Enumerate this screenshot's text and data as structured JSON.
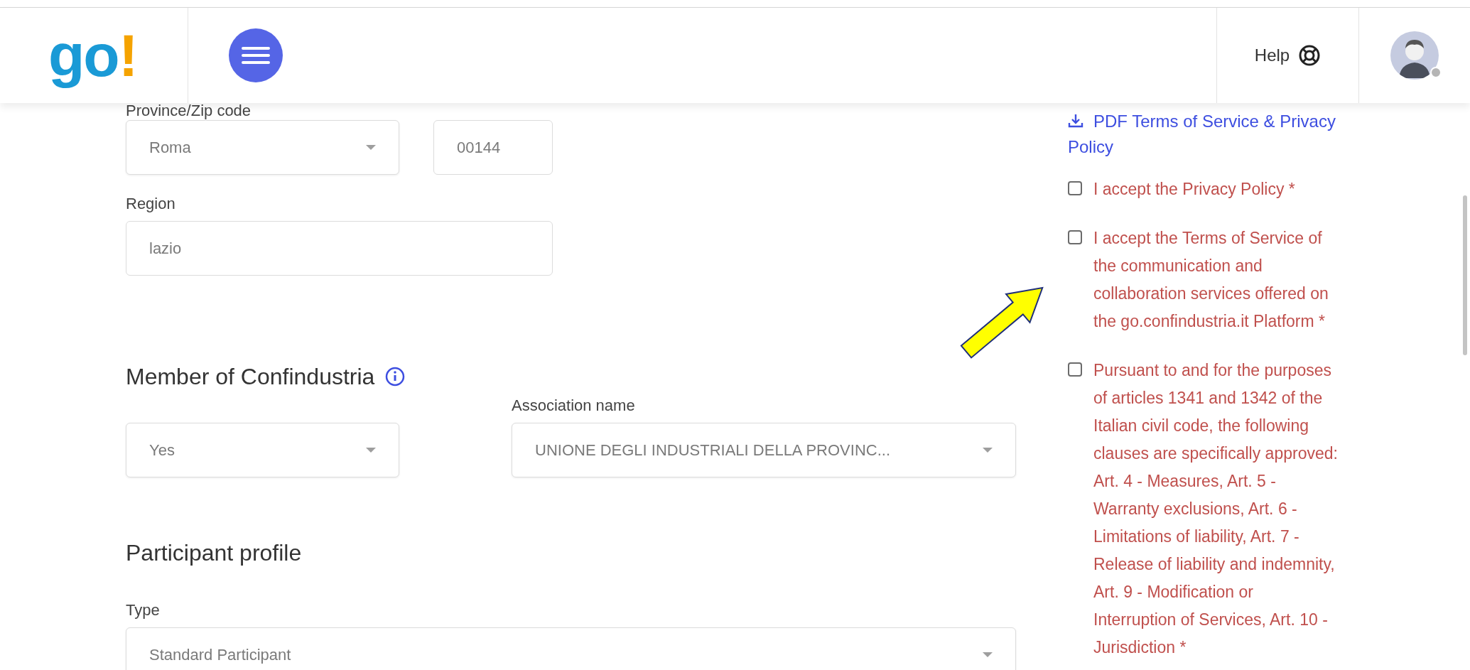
{
  "header": {
    "logo": {
      "letters": "go",
      "mark": "!"
    },
    "help": "Help"
  },
  "form": {
    "province_label": "Province/Zip code",
    "province": {
      "value": "Roma"
    },
    "zip": {
      "value": "00144"
    },
    "region": {
      "label": "Region",
      "value": "lazio"
    },
    "member": {
      "heading": "Member of Confindustria",
      "value": "Yes"
    },
    "association": {
      "label": "Association name",
      "value": "UNIONE DEGLI INDUSTRIALI DELLA PROVINC..."
    },
    "profile": {
      "heading": "Participant profile",
      "type_label": "Type",
      "type_value": "Standard Participant"
    }
  },
  "consent": {
    "pdf_link": "PDF Terms of Service & Privacy Policy",
    "items": [
      {
        "text": "I accept the Privacy Policy *",
        "checked": false
      },
      {
        "text": "I accept the Terms of Service of the communication and collaboration services offered on the go.confindustria.it Platform *",
        "checked": false
      },
      {
        "text": "Pursuant to and for the purposes of articles 1341 and 1342 of the Italian civil code, the following clauses are specifically approved: Art. 4 - Measures, Art. 5 - Warranty exclusions, Art. 6 - Limitations of liability, Art. 7 - Release of liability and indemnity, Art. 9 - Modification or Interruption of Services, Art. 10 - Jurisdiction *",
        "checked": false
      }
    ]
  }
}
